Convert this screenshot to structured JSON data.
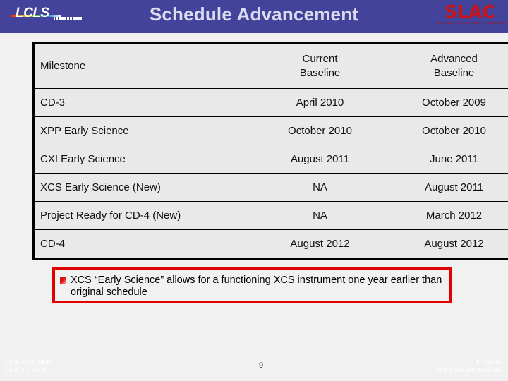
{
  "header": {
    "title": "Schedule Advancement",
    "band_color": "#43439b",
    "title_color": "#dcdcef",
    "lcls_logo_text": "LCLS",
    "slac_logo_text": "SLAC",
    "slac_logo_subtitle": "NATIONAL ACCELERATOR LABORATORY",
    "slac_color": "#c81414"
  },
  "table": {
    "columns": [
      "Milestone",
      "Current\nBaseline",
      "Advanced\nBaseline"
    ],
    "headers": {
      "milestone": "Milestone",
      "current_line1": "Current",
      "current_line2": "Baseline",
      "advanced_line1": "Advanced",
      "advanced_line2": "Baseline"
    },
    "rows": [
      {
        "milestone": "CD-3",
        "current": "April 2010",
        "advanced": "October 2009"
      },
      {
        "milestone": "XPP Early Science",
        "current": "October 2010",
        "advanced": "October 2010"
      },
      {
        "milestone": "CXI Early Science",
        "current": "August 2011",
        "advanced": "June 2011"
      },
      {
        "milestone": "XCS Early Science (New)",
        "current": "NA",
        "advanced": "August 2011"
      },
      {
        "milestone": "Project Ready for CD-4 (New)",
        "current": "NA",
        "advanced": "March 2012"
      },
      {
        "milestone": "CD-4",
        "current": "August 2012",
        "advanced": "August 2012"
      }
    ]
  },
  "callout": {
    "border_color": "#e00000",
    "text": "XCS “Early Science” allows for a functioning XCS instrument one year earlier than original schedule"
  },
  "footer": {
    "left_line1": "LUSI XCS FIDR",
    "left_line2": "June 17, 2009",
    "page_number": "9",
    "right_line1": "T. Fornek",
    "right_line2": "tomf@slac.stanford.edu"
  }
}
